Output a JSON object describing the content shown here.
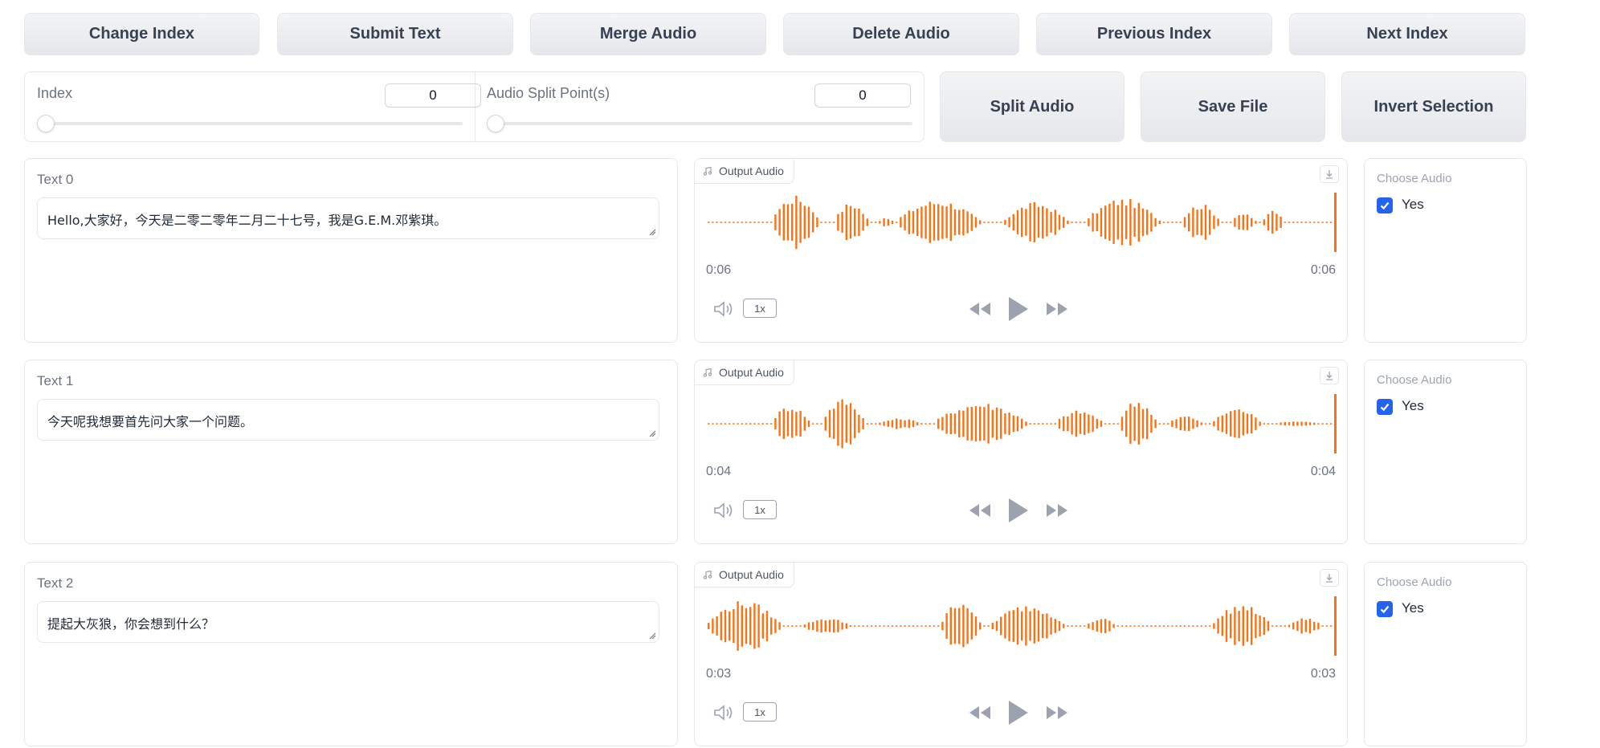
{
  "toolbar": {
    "buttons": [
      "Change Index",
      "Submit Text",
      "Merge Audio",
      "Delete Audio",
      "Previous Index",
      "Next Index"
    ]
  },
  "controls": {
    "index": {
      "label": "Index",
      "value": "0",
      "slider_fraction": 0
    },
    "split": {
      "label": "Audio Split Point(s)",
      "value": "0",
      "slider_fraction": 0
    },
    "buttons": [
      "Split Audio",
      "Save File",
      "Invert Selection"
    ]
  },
  "rows": [
    {
      "text_label": "Text 0",
      "text": "Hello,大家好，今天是二零二零年二月二十七号，我是G.E.M.邓紫琪。",
      "audio_label": "Output Audio",
      "time_start": "0:06",
      "time_end": "0:06",
      "speed": "1x",
      "choose_label": "Choose Audio",
      "checkbox_label": "Yes",
      "checked": true
    },
    {
      "text_label": "Text 1",
      "text": "今天呢我想要首先问大家一个问题。",
      "audio_label": "Output Audio",
      "time_start": "0:04",
      "time_end": "0:04",
      "speed": "1x",
      "choose_label": "Choose Audio",
      "checkbox_label": "Yes",
      "checked": true
    },
    {
      "text_label": "Text 2",
      "text": "提起大灰狼，你会想到什么？",
      "audio_label": "Output Audio",
      "time_start": "0:03",
      "time_end": "0:03",
      "speed": "1x",
      "choose_label": "Choose Audio",
      "checkbox_label": "Yes",
      "checked": true
    }
  ],
  "colors": {
    "waveform": "#f97316",
    "checkbox": "#2563eb",
    "icon": "#9ca3af"
  },
  "icons": [
    "music-note-icon",
    "download-icon",
    "volume-icon",
    "rewind-icon",
    "play-icon",
    "fast-forward-icon",
    "check-icon"
  ]
}
